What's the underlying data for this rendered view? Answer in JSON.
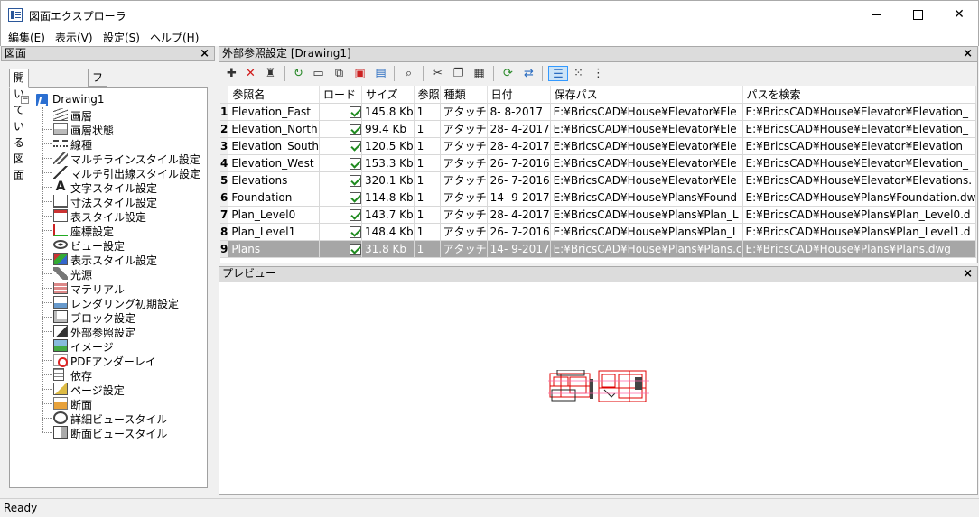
{
  "window": {
    "title": "図面エクスプローラ"
  },
  "menu": [
    "編集(E)",
    "表示(V)",
    "設定(S)",
    "ヘルプ(H)"
  ],
  "left_panel": {
    "header": "図面",
    "tabs": [
      "開いている図面",
      "フォルダ"
    ],
    "root": "Drawing1",
    "items": [
      {
        "label": "画層",
        "icon": "layer-icon"
      },
      {
        "label": "画層状態",
        "icon": "layer-state-icon"
      },
      {
        "label": "線種",
        "icon": "linetype-icon"
      },
      {
        "label": "マルチラインスタイル設定",
        "icon": "multiline-style-icon"
      },
      {
        "label": "マルチ引出線スタイル設定",
        "icon": "multileader-style-icon"
      },
      {
        "label": "文字スタイル設定",
        "icon": "text-style-icon"
      },
      {
        "label": "寸法スタイル設定",
        "icon": "dimension-style-icon"
      },
      {
        "label": "表スタイル設定",
        "icon": "table-style-icon"
      },
      {
        "label": "座標設定",
        "icon": "ucs-icon"
      },
      {
        "label": "ビュー設定",
        "icon": "view-icon"
      },
      {
        "label": "表示スタイル設定",
        "icon": "visual-style-icon"
      },
      {
        "label": "光源",
        "icon": "light-icon"
      },
      {
        "label": "マテリアル",
        "icon": "material-icon"
      },
      {
        "label": "レンダリング初期設定",
        "icon": "render-preset-icon"
      },
      {
        "label": "ブロック設定",
        "icon": "block-icon"
      },
      {
        "label": "外部参照設定",
        "icon": "xref-icon"
      },
      {
        "label": "イメージ",
        "icon": "image-icon"
      },
      {
        "label": "PDFアンダーレイ",
        "icon": "pdf-underlay-icon"
      },
      {
        "label": "依存",
        "icon": "dependency-icon"
      },
      {
        "label": "ページ設定",
        "icon": "page-setup-icon"
      },
      {
        "label": "断面",
        "icon": "section-icon"
      },
      {
        "label": "詳細ビュースタイル",
        "icon": "detail-view-style-icon"
      },
      {
        "label": "断面ビュースタイル",
        "icon": "section-view-style-icon"
      }
    ]
  },
  "xref_panel": {
    "header": "外部参照設定 [Drawing1]",
    "columns": [
      "参照名",
      "ロード",
      "サイズ",
      "参照",
      "種類",
      "日付",
      "保存パス",
      "パスを検索"
    ],
    "rows": [
      {
        "n": "1",
        "name": "Elevation_East",
        "loaded": true,
        "size": "145.8 Kb",
        "refs": "1",
        "type": "アタッチ",
        "date": "8- 8-2017",
        "saved_path": "E:¥BricsCAD¥House¥Elevator¥Ele",
        "found_path": "E:¥BricsCAD¥House¥Elevator¥Elevation_"
      },
      {
        "n": "2",
        "name": "Elevation_North",
        "loaded": true,
        "size": "99.4 Kb",
        "refs": "1",
        "type": "アタッチ",
        "date": "28- 4-2017",
        "saved_path": "E:¥BricsCAD¥House¥Elevator¥Ele",
        "found_path": "E:¥BricsCAD¥House¥Elevator¥Elevation_"
      },
      {
        "n": "3",
        "name": "Elevation_South",
        "loaded": true,
        "size": "120.5 Kb",
        "refs": "1",
        "type": "アタッチ",
        "date": "28- 4-2017",
        "saved_path": "E:¥BricsCAD¥House¥Elevator¥Ele",
        "found_path": "E:¥BricsCAD¥House¥Elevator¥Elevation_"
      },
      {
        "n": "4",
        "name": "Elevation_West",
        "loaded": true,
        "size": "153.3 Kb",
        "refs": "1",
        "type": "アタッチ",
        "date": "26- 7-2016",
        "saved_path": "E:¥BricsCAD¥House¥Elevator¥Ele",
        "found_path": "E:¥BricsCAD¥House¥Elevator¥Elevation_"
      },
      {
        "n": "5",
        "name": "Elevations",
        "loaded": true,
        "size": "320.1 Kb",
        "refs": "1",
        "type": "アタッチ",
        "date": "26- 7-2016",
        "saved_path": "E:¥BricsCAD¥House¥Elevator¥Ele",
        "found_path": "E:¥BricsCAD¥House¥Elevator¥Elevations."
      },
      {
        "n": "6",
        "name": "Foundation",
        "loaded": true,
        "size": "114.8 Kb",
        "refs": "1",
        "type": "アタッチ",
        "date": "14- 9-2017",
        "saved_path": "E:¥BricsCAD¥House¥Plans¥Found",
        "found_path": "E:¥BricsCAD¥House¥Plans¥Foundation.dw"
      },
      {
        "n": "7",
        "name": "Plan_Level0",
        "loaded": true,
        "size": "143.7 Kb",
        "refs": "1",
        "type": "アタッチ",
        "date": "28- 4-2017",
        "saved_path": "E:¥BricsCAD¥House¥Plans¥Plan_L",
        "found_path": "E:¥BricsCAD¥House¥Plans¥Plan_Level0.d"
      },
      {
        "n": "8",
        "name": "Plan_Level1",
        "loaded": true,
        "size": "148.4 Kb",
        "refs": "1",
        "type": "アタッチ",
        "date": "26- 7-2016",
        "saved_path": "E:¥BricsCAD¥House¥Plans¥Plan_L",
        "found_path": "E:¥BricsCAD¥House¥Plans¥Plan_Level1.d"
      },
      {
        "n": "9",
        "name": "Plans",
        "loaded": true,
        "size": "31.8 Kb",
        "refs": "1",
        "type": "アタッチ",
        "date": "14- 9-2017",
        "saved_path": "E:¥BricsCAD¥House¥Plans¥Plans.c",
        "found_path": "E:¥BricsCAD¥House¥Plans¥Plans.dwg",
        "selected": true
      }
    ]
  },
  "preview_panel": {
    "header": "プレビュー"
  },
  "status": {
    "text": "Ready"
  },
  "colors": {
    "selected_row": "#a6a6a6",
    "check": "#1e8a1e",
    "preview_red": "#e00000"
  }
}
